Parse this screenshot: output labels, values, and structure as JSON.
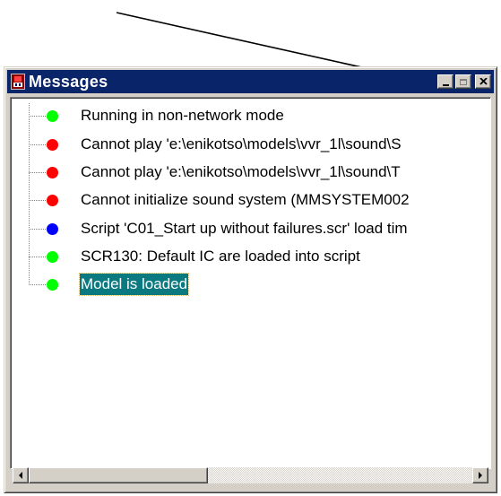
{
  "window": {
    "title": "Messages",
    "title_bar_color": "#0a246a",
    "buttons": {
      "minimize": "minimize",
      "maximize": "maximize",
      "close": "close"
    }
  },
  "messages": [
    {
      "text": "Running in non-network mode",
      "status": "ok",
      "color": "#00ff00",
      "selected": false
    },
    {
      "text": "Cannot play 'e:\\enikotso\\models\\vvr_1l\\sound\\S",
      "status": "error",
      "color": "#ff0000",
      "selected": false
    },
    {
      "text": "Cannot play 'e:\\enikotso\\models\\vvr_1l\\sound\\T",
      "status": "error",
      "color": "#ff0000",
      "selected": false
    },
    {
      "text": "Cannot initialize sound system (MMSYSTEM002",
      "status": "error",
      "color": "#ff0000",
      "selected": false
    },
    {
      "text": "Script 'C01_Start up without  failures.scr' load tim",
      "status": "info",
      "color": "#0000ff",
      "selected": false
    },
    {
      "text": "SCR130: Default IC are loaded into script",
      "status": "ok",
      "color": "#00ff00",
      "selected": false
    },
    {
      "text": "Model is loaded",
      "status": "ok",
      "color": "#00ff00",
      "selected": true
    }
  ],
  "colors": {
    "selection_background": "#0b7a80",
    "window_face": "#d4d0c8"
  },
  "icons": {
    "title": "messages-app-icon",
    "arrow": "annotation-arrow"
  }
}
